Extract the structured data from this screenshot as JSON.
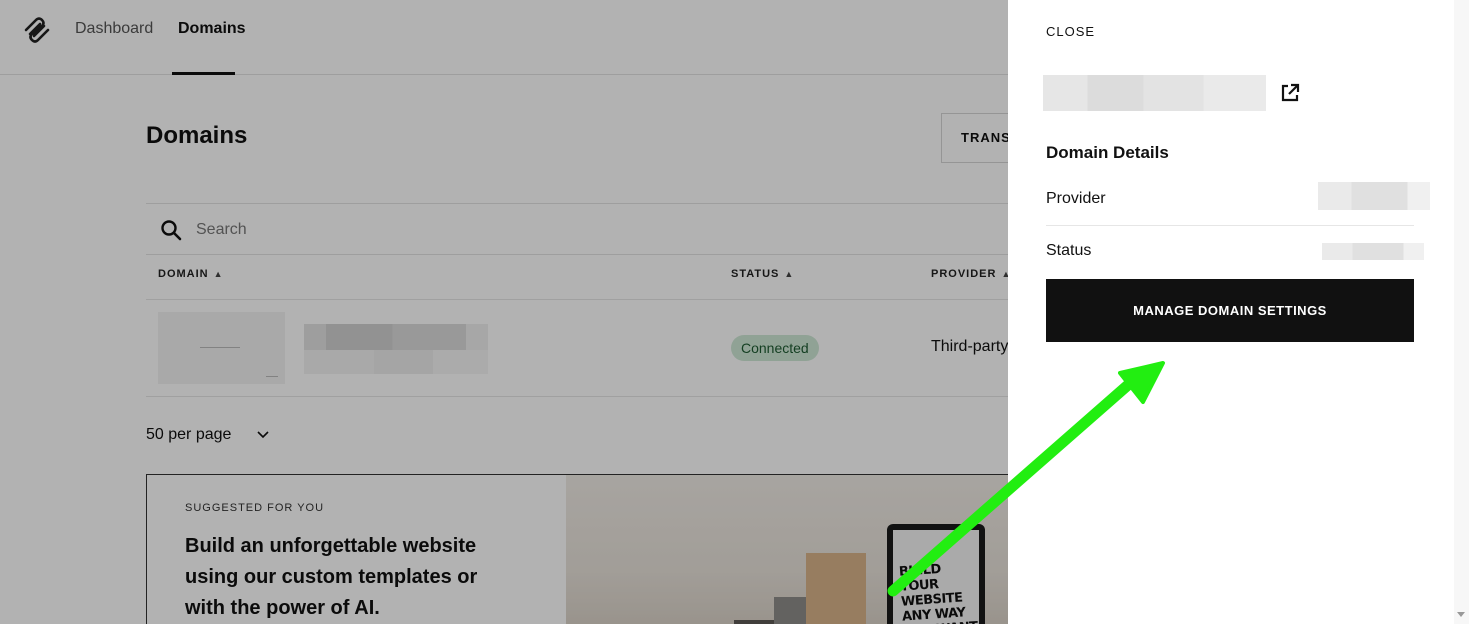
{
  "nav": {
    "logo_icon": "squarespace-logo-icon",
    "items": [
      {
        "label": "Dashboard",
        "active": false
      },
      {
        "label": "Domains",
        "active": true
      }
    ]
  },
  "main": {
    "title": "Domains",
    "transfer_button": "TRANSFER DOMAIN",
    "search": {
      "placeholder": "Search",
      "icon": "search-icon"
    },
    "table": {
      "columns": [
        "DOMAIN",
        "STATUS",
        "PROVIDER"
      ],
      "sort_icon": "sort-arrows-icon",
      "rows": [
        {
          "status": "Connected",
          "provider": "Third-party"
        }
      ]
    },
    "pagination": {
      "per_page": "50 per page",
      "icon": "chevron-down-icon"
    },
    "promo": {
      "eyebrow": "SUGGESTED FOR YOU",
      "heading": "Build an unforgettable website using our custom templates or with the power of AI.",
      "image_text": "BUILD YOUR WEBSITE ANY WAY YOU WANT"
    }
  },
  "panel": {
    "close_label": "CLOSE",
    "external_link_icon": "external-link-icon",
    "details_title": "Domain Details",
    "rows": [
      {
        "label": "Provider"
      },
      {
        "label": "Status"
      }
    ],
    "manage_button": "MANAGE DOMAIN SETTINGS"
  },
  "colors": {
    "accent_dark": "#111111",
    "status_connected_bg": "#cfe9d6",
    "status_connected_text": "#1e5b32",
    "annotation_arrow": "#22ee11"
  }
}
